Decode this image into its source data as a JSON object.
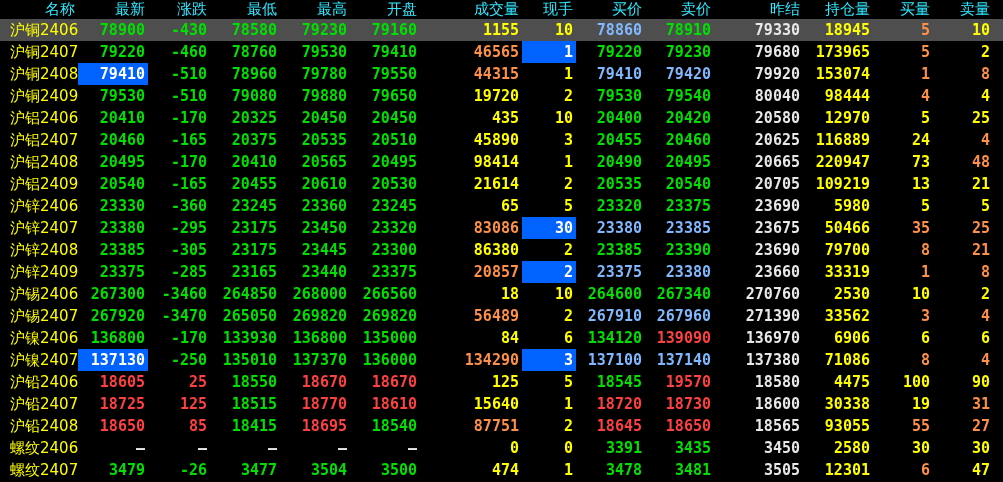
{
  "columns": [
    "名称",
    "最新",
    "涨跌",
    "最低",
    "最高",
    "开盘",
    "成交量",
    "现手",
    "买价",
    "卖价",
    "昨结",
    "持仓量",
    "买量",
    "卖量"
  ],
  "rows": [
    {
      "name": "沪铜2406",
      "selected": true,
      "cells": [
        {
          "text": "78900",
          "color": "#00e000",
          "highlighted": false
        },
        {
          "text": "-430",
          "color": "#00e000",
          "highlighted": false
        },
        {
          "text": "78580",
          "color": "#00e000",
          "highlighted": false
        },
        {
          "text": "79230",
          "color": "#00e000",
          "highlighted": false
        },
        {
          "text": "79160",
          "color": "#00e000",
          "highlighted": false
        },
        {
          "text": "1155",
          "color": "#ffff00",
          "highlighted": false
        },
        {
          "text": "10",
          "color": "#ffff00",
          "highlighted": false
        },
        {
          "text": "78860",
          "color": "#80b8ff",
          "highlighted": false
        },
        {
          "text": "78910",
          "color": "#00e000",
          "highlighted": false
        },
        {
          "text": "79330",
          "color": "#e8e8e8",
          "highlighted": false
        },
        {
          "text": "18945",
          "color": "#ffff00",
          "highlighted": false
        },
        {
          "text": "5",
          "color": "#ff9048",
          "highlighted": false
        },
        {
          "text": "10",
          "color": "#ffff00",
          "highlighted": false
        }
      ]
    },
    {
      "name": "沪铜2407",
      "selected": false,
      "cells": [
        {
          "text": "79220",
          "color": "#00e000",
          "highlighted": false
        },
        {
          "text": "-460",
          "color": "#00e000",
          "highlighted": false
        },
        {
          "text": "78760",
          "color": "#00e000",
          "highlighted": false
        },
        {
          "text": "79530",
          "color": "#00e000",
          "highlighted": false
        },
        {
          "text": "79410",
          "color": "#00e000",
          "highlighted": false
        },
        {
          "text": "46565",
          "color": "#ff9048",
          "highlighted": false
        },
        {
          "text": "1",
          "color": "#ffffff",
          "highlighted": true
        },
        {
          "text": "79220",
          "color": "#00e000",
          "highlighted": false
        },
        {
          "text": "79230",
          "color": "#00e000",
          "highlighted": false
        },
        {
          "text": "79680",
          "color": "#e8e8e8",
          "highlighted": false
        },
        {
          "text": "173965",
          "color": "#ffff00",
          "highlighted": false
        },
        {
          "text": "5",
          "color": "#ff9048",
          "highlighted": false
        },
        {
          "text": "2",
          "color": "#ffff00",
          "highlighted": false
        }
      ]
    },
    {
      "name": "沪铜2408",
      "selected": false,
      "cells": [
        {
          "text": "79410",
          "color": "#ffffff",
          "highlighted": true
        },
        {
          "text": "-510",
          "color": "#00e000",
          "highlighted": false
        },
        {
          "text": "78960",
          "color": "#00e000",
          "highlighted": false
        },
        {
          "text": "79780",
          "color": "#00e000",
          "highlighted": false
        },
        {
          "text": "79550",
          "color": "#00e000",
          "highlighted": false
        },
        {
          "text": "44315",
          "color": "#ff9048",
          "highlighted": false
        },
        {
          "text": "1",
          "color": "#ffff00",
          "highlighted": false
        },
        {
          "text": "79410",
          "color": "#80b8ff",
          "highlighted": false
        },
        {
          "text": "79420",
          "color": "#80b8ff",
          "highlighted": false
        },
        {
          "text": "79920",
          "color": "#e8e8e8",
          "highlighted": false
        },
        {
          "text": "153074",
          "color": "#ffff00",
          "highlighted": false
        },
        {
          "text": "1",
          "color": "#ff9048",
          "highlighted": false
        },
        {
          "text": "8",
          "color": "#ff9048",
          "highlighted": false
        }
      ]
    },
    {
      "name": "沪铜2409",
      "selected": false,
      "cells": [
        {
          "text": "79530",
          "color": "#00e000",
          "highlighted": false
        },
        {
          "text": "-510",
          "color": "#00e000",
          "highlighted": false
        },
        {
          "text": "79080",
          "color": "#00e000",
          "highlighted": false
        },
        {
          "text": "79880",
          "color": "#00e000",
          "highlighted": false
        },
        {
          "text": "79650",
          "color": "#00e000",
          "highlighted": false
        },
        {
          "text": "19720",
          "color": "#ffff00",
          "highlighted": false
        },
        {
          "text": "2",
          "color": "#ffff00",
          "highlighted": false
        },
        {
          "text": "79530",
          "color": "#00e000",
          "highlighted": false
        },
        {
          "text": "79540",
          "color": "#00e000",
          "highlighted": false
        },
        {
          "text": "80040",
          "color": "#e8e8e8",
          "highlighted": false
        },
        {
          "text": "98444",
          "color": "#ffff00",
          "highlighted": false
        },
        {
          "text": "4",
          "color": "#ff9048",
          "highlighted": false
        },
        {
          "text": "4",
          "color": "#ffff00",
          "highlighted": false
        }
      ]
    },
    {
      "name": "沪铝2406",
      "selected": false,
      "cells": [
        {
          "text": "20410",
          "color": "#00e000",
          "highlighted": false
        },
        {
          "text": "-170",
          "color": "#00e000",
          "highlighted": false
        },
        {
          "text": "20325",
          "color": "#00e000",
          "highlighted": false
        },
        {
          "text": "20450",
          "color": "#00e000",
          "highlighted": false
        },
        {
          "text": "20450",
          "color": "#00e000",
          "highlighted": false
        },
        {
          "text": "435",
          "color": "#ffff00",
          "highlighted": false
        },
        {
          "text": "10",
          "color": "#ffff00",
          "highlighted": false
        },
        {
          "text": "20400",
          "color": "#00e000",
          "highlighted": false
        },
        {
          "text": "20420",
          "color": "#00e000",
          "highlighted": false
        },
        {
          "text": "20580",
          "color": "#e8e8e8",
          "highlighted": false
        },
        {
          "text": "12970",
          "color": "#ffff00",
          "highlighted": false
        },
        {
          "text": "5",
          "color": "#ffff00",
          "highlighted": false
        },
        {
          "text": "25",
          "color": "#ffff00",
          "highlighted": false
        }
      ]
    },
    {
      "name": "沪铝2407",
      "selected": false,
      "cells": [
        {
          "text": "20460",
          "color": "#00e000",
          "highlighted": false
        },
        {
          "text": "-165",
          "color": "#00e000",
          "highlighted": false
        },
        {
          "text": "20375",
          "color": "#00e000",
          "highlighted": false
        },
        {
          "text": "20535",
          "color": "#00e000",
          "highlighted": false
        },
        {
          "text": "20510",
          "color": "#00e000",
          "highlighted": false
        },
        {
          "text": "45890",
          "color": "#ffff00",
          "highlighted": false
        },
        {
          "text": "3",
          "color": "#ffff00",
          "highlighted": false
        },
        {
          "text": "20455",
          "color": "#00e000",
          "highlighted": false
        },
        {
          "text": "20460",
          "color": "#00e000",
          "highlighted": false
        },
        {
          "text": "20625",
          "color": "#e8e8e8",
          "highlighted": false
        },
        {
          "text": "116889",
          "color": "#ffff00",
          "highlighted": false
        },
        {
          "text": "24",
          "color": "#ffff00",
          "highlighted": false
        },
        {
          "text": "4",
          "color": "#ff9048",
          "highlighted": false
        }
      ]
    },
    {
      "name": "沪铝2408",
      "selected": false,
      "cells": [
        {
          "text": "20495",
          "color": "#00e000",
          "highlighted": false
        },
        {
          "text": "-170",
          "color": "#00e000",
          "highlighted": false
        },
        {
          "text": "20410",
          "color": "#00e000",
          "highlighted": false
        },
        {
          "text": "20565",
          "color": "#00e000",
          "highlighted": false
        },
        {
          "text": "20495",
          "color": "#00e000",
          "highlighted": false
        },
        {
          "text": "98414",
          "color": "#ffff00",
          "highlighted": false
        },
        {
          "text": "1",
          "color": "#ffff00",
          "highlighted": false
        },
        {
          "text": "20490",
          "color": "#00e000",
          "highlighted": false
        },
        {
          "text": "20495",
          "color": "#00e000",
          "highlighted": false
        },
        {
          "text": "20665",
          "color": "#e8e8e8",
          "highlighted": false
        },
        {
          "text": "220947",
          "color": "#ffff00",
          "highlighted": false
        },
        {
          "text": "73",
          "color": "#ffff00",
          "highlighted": false
        },
        {
          "text": "48",
          "color": "#ff9048",
          "highlighted": false
        }
      ]
    },
    {
      "name": "沪铝2409",
      "selected": false,
      "cells": [
        {
          "text": "20540",
          "color": "#00e000",
          "highlighted": false
        },
        {
          "text": "-165",
          "color": "#00e000",
          "highlighted": false
        },
        {
          "text": "20455",
          "color": "#00e000",
          "highlighted": false
        },
        {
          "text": "20610",
          "color": "#00e000",
          "highlighted": false
        },
        {
          "text": "20530",
          "color": "#00e000",
          "highlighted": false
        },
        {
          "text": "21614",
          "color": "#ffff00",
          "highlighted": false
        },
        {
          "text": "2",
          "color": "#ffff00",
          "highlighted": false
        },
        {
          "text": "20535",
          "color": "#00e000",
          "highlighted": false
        },
        {
          "text": "20540",
          "color": "#00e000",
          "highlighted": false
        },
        {
          "text": "20705",
          "color": "#e8e8e8",
          "highlighted": false
        },
        {
          "text": "109219",
          "color": "#ffff00",
          "highlighted": false
        },
        {
          "text": "13",
          "color": "#ffff00",
          "highlighted": false
        },
        {
          "text": "21",
          "color": "#ffff00",
          "highlighted": false
        }
      ]
    },
    {
      "name": "沪锌2406",
      "selected": false,
      "cells": [
        {
          "text": "23330",
          "color": "#00e000",
          "highlighted": false
        },
        {
          "text": "-360",
          "color": "#00e000",
          "highlighted": false
        },
        {
          "text": "23245",
          "color": "#00e000",
          "highlighted": false
        },
        {
          "text": "23360",
          "color": "#00e000",
          "highlighted": false
        },
        {
          "text": "23245",
          "color": "#00e000",
          "highlighted": false
        },
        {
          "text": "65",
          "color": "#ffff00",
          "highlighted": false
        },
        {
          "text": "5",
          "color": "#ffff00",
          "highlighted": false
        },
        {
          "text": "23320",
          "color": "#00e000",
          "highlighted": false
        },
        {
          "text": "23375",
          "color": "#00e000",
          "highlighted": false
        },
        {
          "text": "23690",
          "color": "#e8e8e8",
          "highlighted": false
        },
        {
          "text": "5980",
          "color": "#ffff00",
          "highlighted": false
        },
        {
          "text": "5",
          "color": "#ffff00",
          "highlighted": false
        },
        {
          "text": "5",
          "color": "#ffff00",
          "highlighted": false
        }
      ]
    },
    {
      "name": "沪锌2407",
      "selected": false,
      "cells": [
        {
          "text": "23380",
          "color": "#00e000",
          "highlighted": false
        },
        {
          "text": "-295",
          "color": "#00e000",
          "highlighted": false
        },
        {
          "text": "23175",
          "color": "#00e000",
          "highlighted": false
        },
        {
          "text": "23450",
          "color": "#00e000",
          "highlighted": false
        },
        {
          "text": "23320",
          "color": "#00e000",
          "highlighted": false
        },
        {
          "text": "83086",
          "color": "#ff9048",
          "highlighted": false
        },
        {
          "text": "30",
          "color": "#ffffff",
          "highlighted": true
        },
        {
          "text": "23380",
          "color": "#80b8ff",
          "highlighted": false
        },
        {
          "text": "23385",
          "color": "#80b8ff",
          "highlighted": false
        },
        {
          "text": "23675",
          "color": "#e8e8e8",
          "highlighted": false
        },
        {
          "text": "50466",
          "color": "#ffff00",
          "highlighted": false
        },
        {
          "text": "35",
          "color": "#ff9048",
          "highlighted": false
        },
        {
          "text": "25",
          "color": "#ff9048",
          "highlighted": false
        }
      ]
    },
    {
      "name": "沪锌2408",
      "selected": false,
      "cells": [
        {
          "text": "23385",
          "color": "#00e000",
          "highlighted": false
        },
        {
          "text": "-305",
          "color": "#00e000",
          "highlighted": false
        },
        {
          "text": "23175",
          "color": "#00e000",
          "highlighted": false
        },
        {
          "text": "23445",
          "color": "#00e000",
          "highlighted": false
        },
        {
          "text": "23300",
          "color": "#00e000",
          "highlighted": false
        },
        {
          "text": "86380",
          "color": "#ffff00",
          "highlighted": false
        },
        {
          "text": "2",
          "color": "#ffff00",
          "highlighted": false
        },
        {
          "text": "23385",
          "color": "#00e000",
          "highlighted": false
        },
        {
          "text": "23390",
          "color": "#00e000",
          "highlighted": false
        },
        {
          "text": "23690",
          "color": "#e8e8e8",
          "highlighted": false
        },
        {
          "text": "79700",
          "color": "#ffff00",
          "highlighted": false
        },
        {
          "text": "8",
          "color": "#ff9048",
          "highlighted": false
        },
        {
          "text": "21",
          "color": "#ff9048",
          "highlighted": false
        }
      ]
    },
    {
      "name": "沪锌2409",
      "selected": false,
      "cells": [
        {
          "text": "23375",
          "color": "#00e000",
          "highlighted": false
        },
        {
          "text": "-285",
          "color": "#00e000",
          "highlighted": false
        },
        {
          "text": "23165",
          "color": "#00e000",
          "highlighted": false
        },
        {
          "text": "23440",
          "color": "#00e000",
          "highlighted": false
        },
        {
          "text": "23375",
          "color": "#00e000",
          "highlighted": false
        },
        {
          "text": "20857",
          "color": "#ff9048",
          "highlighted": false
        },
        {
          "text": "2",
          "color": "#ffffff",
          "highlighted": true
        },
        {
          "text": "23375",
          "color": "#80b8ff",
          "highlighted": false
        },
        {
          "text": "23380",
          "color": "#80b8ff",
          "highlighted": false
        },
        {
          "text": "23660",
          "color": "#e8e8e8",
          "highlighted": false
        },
        {
          "text": "33319",
          "color": "#ffff00",
          "highlighted": false
        },
        {
          "text": "1",
          "color": "#ff9048",
          "highlighted": false
        },
        {
          "text": "8",
          "color": "#ff9048",
          "highlighted": false
        }
      ]
    },
    {
      "name": "沪锡2406",
      "selected": false,
      "cells": [
        {
          "text": "267300",
          "color": "#00e000",
          "highlighted": false
        },
        {
          "text": "-3460",
          "color": "#00e000",
          "highlighted": false
        },
        {
          "text": "264850",
          "color": "#00e000",
          "highlighted": false
        },
        {
          "text": "268000",
          "color": "#00e000",
          "highlighted": false
        },
        {
          "text": "266560",
          "color": "#00e000",
          "highlighted": false
        },
        {
          "text": "18",
          "color": "#ffff00",
          "highlighted": false
        },
        {
          "text": "10",
          "color": "#ffff00",
          "highlighted": false
        },
        {
          "text": "264600",
          "color": "#00e000",
          "highlighted": false
        },
        {
          "text": "267340",
          "color": "#00e000",
          "highlighted": false
        },
        {
          "text": "270760",
          "color": "#e8e8e8",
          "highlighted": false
        },
        {
          "text": "2530",
          "color": "#ffff00",
          "highlighted": false
        },
        {
          "text": "10",
          "color": "#ffff00",
          "highlighted": false
        },
        {
          "text": "2",
          "color": "#ffff00",
          "highlighted": false
        }
      ]
    },
    {
      "name": "沪锡2407",
      "selected": false,
      "cells": [
        {
          "text": "267920",
          "color": "#00e000",
          "highlighted": false
        },
        {
          "text": "-3470",
          "color": "#00e000",
          "highlighted": false
        },
        {
          "text": "265050",
          "color": "#00e000",
          "highlighted": false
        },
        {
          "text": "269820",
          "color": "#00e000",
          "highlighted": false
        },
        {
          "text": "269820",
          "color": "#00e000",
          "highlighted": false
        },
        {
          "text": "56489",
          "color": "#ff9048",
          "highlighted": false
        },
        {
          "text": "2",
          "color": "#ffff00",
          "highlighted": false
        },
        {
          "text": "267910",
          "color": "#80b8ff",
          "highlighted": false
        },
        {
          "text": "267960",
          "color": "#80b8ff",
          "highlighted": false
        },
        {
          "text": "271390",
          "color": "#e8e8e8",
          "highlighted": false
        },
        {
          "text": "33562",
          "color": "#ffff00",
          "highlighted": false
        },
        {
          "text": "3",
          "color": "#ff9048",
          "highlighted": false
        },
        {
          "text": "4",
          "color": "#ff9048",
          "highlighted": false
        }
      ]
    },
    {
      "name": "沪镍2406",
      "selected": false,
      "cells": [
        {
          "text": "136800",
          "color": "#00e000",
          "highlighted": false
        },
        {
          "text": "-170",
          "color": "#00e000",
          "highlighted": false
        },
        {
          "text": "133930",
          "color": "#00e000",
          "highlighted": false
        },
        {
          "text": "136800",
          "color": "#00e000",
          "highlighted": false
        },
        {
          "text": "135000",
          "color": "#00e000",
          "highlighted": false
        },
        {
          "text": "84",
          "color": "#ffff00",
          "highlighted": false
        },
        {
          "text": "6",
          "color": "#ffff00",
          "highlighted": false
        },
        {
          "text": "134120",
          "color": "#00e000",
          "highlighted": false
        },
        {
          "text": "139090",
          "color": "#ff4040",
          "highlighted": false
        },
        {
          "text": "136970",
          "color": "#e8e8e8",
          "highlighted": false
        },
        {
          "text": "6906",
          "color": "#ffff00",
          "highlighted": false
        },
        {
          "text": "6",
          "color": "#ffff00",
          "highlighted": false
        },
        {
          "text": "6",
          "color": "#ffff00",
          "highlighted": false
        }
      ]
    },
    {
      "name": "沪镍2407",
      "selected": false,
      "cells": [
        {
          "text": "137130",
          "color": "#ffffff",
          "highlighted": true
        },
        {
          "text": "-250",
          "color": "#00e000",
          "highlighted": false
        },
        {
          "text": "135010",
          "color": "#00e000",
          "highlighted": false
        },
        {
          "text": "137370",
          "color": "#00e000",
          "highlighted": false
        },
        {
          "text": "136000",
          "color": "#00e000",
          "highlighted": false
        },
        {
          "text": "134290",
          "color": "#ff9048",
          "highlighted": false
        },
        {
          "text": "3",
          "color": "#ffffff",
          "highlighted": true
        },
        {
          "text": "137100",
          "color": "#80b8ff",
          "highlighted": false
        },
        {
          "text": "137140",
          "color": "#80b8ff",
          "highlighted": false
        },
        {
          "text": "137380",
          "color": "#e8e8e8",
          "highlighted": false
        },
        {
          "text": "71086",
          "color": "#ffff00",
          "highlighted": false
        },
        {
          "text": "8",
          "color": "#ff9048",
          "highlighted": false
        },
        {
          "text": "4",
          "color": "#ff9048",
          "highlighted": false
        }
      ]
    },
    {
      "name": "沪铅2406",
      "selected": false,
      "cells": [
        {
          "text": "18605",
          "color": "#ff4040",
          "highlighted": false
        },
        {
          "text": "25",
          "color": "#ff4040",
          "highlighted": false
        },
        {
          "text": "18550",
          "color": "#00e000",
          "highlighted": false
        },
        {
          "text": "18670",
          "color": "#ff4040",
          "highlighted": false
        },
        {
          "text": "18670",
          "color": "#ff4040",
          "highlighted": false
        },
        {
          "text": "125",
          "color": "#ffff00",
          "highlighted": false
        },
        {
          "text": "5",
          "color": "#ffff00",
          "highlighted": false
        },
        {
          "text": "18545",
          "color": "#00e000",
          "highlighted": false
        },
        {
          "text": "19570",
          "color": "#ff4040",
          "highlighted": false
        },
        {
          "text": "18580",
          "color": "#e8e8e8",
          "highlighted": false
        },
        {
          "text": "4475",
          "color": "#ffff00",
          "highlighted": false
        },
        {
          "text": "100",
          "color": "#ffff00",
          "highlighted": false
        },
        {
          "text": "90",
          "color": "#ffff00",
          "highlighted": false
        }
      ]
    },
    {
      "name": "沪铅2407",
      "selected": false,
      "cells": [
        {
          "text": "18725",
          "color": "#ff4040",
          "highlighted": false
        },
        {
          "text": "125",
          "color": "#ff4040",
          "highlighted": false
        },
        {
          "text": "18515",
          "color": "#00e000",
          "highlighted": false
        },
        {
          "text": "18770",
          "color": "#ff4040",
          "highlighted": false
        },
        {
          "text": "18610",
          "color": "#ff4040",
          "highlighted": false
        },
        {
          "text": "15640",
          "color": "#ffff00",
          "highlighted": false
        },
        {
          "text": "1",
          "color": "#ffff00",
          "highlighted": false
        },
        {
          "text": "18720",
          "color": "#ff4040",
          "highlighted": false
        },
        {
          "text": "18730",
          "color": "#ff4040",
          "highlighted": false
        },
        {
          "text": "18600",
          "color": "#e8e8e8",
          "highlighted": false
        },
        {
          "text": "30338",
          "color": "#ffff00",
          "highlighted": false
        },
        {
          "text": "19",
          "color": "#ffff00",
          "highlighted": false
        },
        {
          "text": "31",
          "color": "#ff9048",
          "highlighted": false
        }
      ]
    },
    {
      "name": "沪铅2408",
      "selected": false,
      "cells": [
        {
          "text": "18650",
          "color": "#ff4040",
          "highlighted": false
        },
        {
          "text": "85",
          "color": "#ff4040",
          "highlighted": false
        },
        {
          "text": "18415",
          "color": "#00e000",
          "highlighted": false
        },
        {
          "text": "18695",
          "color": "#ff4040",
          "highlighted": false
        },
        {
          "text": "18540",
          "color": "#00e000",
          "highlighted": false
        },
        {
          "text": "87751",
          "color": "#ff9048",
          "highlighted": false
        },
        {
          "text": "2",
          "color": "#ffff00",
          "highlighted": false
        },
        {
          "text": "18645",
          "color": "#ff4040",
          "highlighted": false
        },
        {
          "text": "18650",
          "color": "#ff4040",
          "highlighted": false
        },
        {
          "text": "18565",
          "color": "#e8e8e8",
          "highlighted": false
        },
        {
          "text": "93055",
          "color": "#ffff00",
          "highlighted": false
        },
        {
          "text": "55",
          "color": "#ff9048",
          "highlighted": false
        },
        {
          "text": "27",
          "color": "#ff9048",
          "highlighted": false
        }
      ]
    },
    {
      "name": "螺纹2406",
      "selected": false,
      "cells": [
        {
          "text": "—",
          "color": "#e8e8e8",
          "highlighted": false
        },
        {
          "text": "—",
          "color": "#e8e8e8",
          "highlighted": false
        },
        {
          "text": "—",
          "color": "#e8e8e8",
          "highlighted": false
        },
        {
          "text": "—",
          "color": "#e8e8e8",
          "highlighted": false
        },
        {
          "text": "—",
          "color": "#e8e8e8",
          "highlighted": false
        },
        {
          "text": "0",
          "color": "#ffff00",
          "highlighted": false
        },
        {
          "text": "0",
          "color": "#ffff00",
          "highlighted": false
        },
        {
          "text": "3391",
          "color": "#00e000",
          "highlighted": false
        },
        {
          "text": "3435",
          "color": "#00e000",
          "highlighted": false
        },
        {
          "text": "3450",
          "color": "#e8e8e8",
          "highlighted": false
        },
        {
          "text": "2580",
          "color": "#ffff00",
          "highlighted": false
        },
        {
          "text": "30",
          "color": "#ffff00",
          "highlighted": false
        },
        {
          "text": "30",
          "color": "#ffff00",
          "highlighted": false
        }
      ]
    },
    {
      "name": "螺纹2407",
      "selected": false,
      "cells": [
        {
          "text": "3479",
          "color": "#00e000",
          "highlighted": false
        },
        {
          "text": "-26",
          "color": "#00e000",
          "highlighted": false
        },
        {
          "text": "3477",
          "color": "#00e000",
          "highlighted": false
        },
        {
          "text": "3504",
          "color": "#00e000",
          "highlighted": false
        },
        {
          "text": "3500",
          "color": "#00e000",
          "highlighted": false
        },
        {
          "text": "474",
          "color": "#ffff00",
          "highlighted": false
        },
        {
          "text": "1",
          "color": "#ffff00",
          "highlighted": false
        },
        {
          "text": "3478",
          "color": "#00e000",
          "highlighted": false
        },
        {
          "text": "3481",
          "color": "#00e000",
          "highlighted": false
        },
        {
          "text": "3505",
          "color": "#e8e8e8",
          "highlighted": false
        },
        {
          "text": "12301",
          "color": "#ffff00",
          "highlighted": false
        },
        {
          "text": "6",
          "color": "#ff9048",
          "highlighted": false
        },
        {
          "text": "47",
          "color": "#ffff00",
          "highlighted": false
        }
      ]
    }
  ]
}
